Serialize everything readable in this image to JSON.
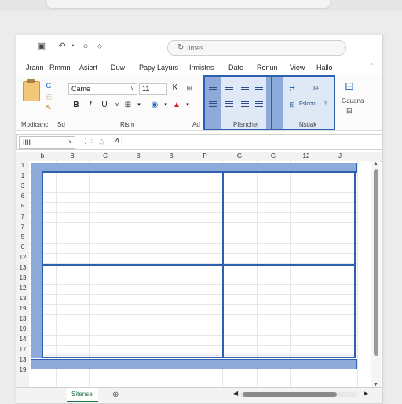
{
  "search": {
    "text": "Ilmes"
  },
  "menu": [
    {
      "label": "Jrann"
    },
    {
      "label": "Rmmn"
    },
    {
      "label": "Asiert"
    },
    {
      "label": "Duw"
    },
    {
      "label": "Papy Layurs"
    },
    {
      "label": "Irmistns"
    },
    {
      "label": "Date"
    },
    {
      "label": "Renun"
    },
    {
      "label": "View"
    },
    {
      "label": "Hallo"
    }
  ],
  "ribbon": {
    "font_name": "Came",
    "font_size": "11",
    "k_label": "K",
    "bold": "B",
    "italic": "f",
    "underline": "U",
    "groups": {
      "clipboard": "Modicanc",
      "sd": "Sd",
      "font": "Rism",
      "ad": "Ad",
      "alignment": "Plisnchel",
      "number": "Nstiak",
      "general": "Gauana"
    },
    "number_format": "Fslcon",
    "ie_label": "Ie"
  },
  "formula": {
    "name_box": "IIII",
    "fx": "A"
  },
  "columns": [
    "b",
    "B",
    "C",
    "B",
    "B",
    "P",
    "G",
    "G",
    "12",
    "J"
  ],
  "rows": [
    "1",
    "1",
    "3",
    "6",
    "5",
    "7",
    "7",
    "5",
    "0",
    "12",
    "13",
    "13",
    "12",
    "13",
    "19",
    "13",
    "19",
    "14",
    "17",
    "13",
    "19"
  ],
  "sheet": {
    "tab": "Sitense"
  },
  "colors": {
    "accent_blue": "#2f5fb0",
    "selection_fill": "#8eaad9",
    "excel_green": "#1e7145"
  }
}
